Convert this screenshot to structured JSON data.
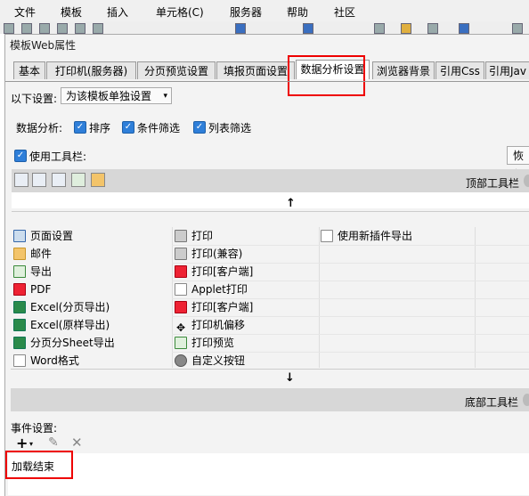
{
  "menu": [
    "文件",
    "模板",
    "插入",
    "单元格(C)",
    "服务器",
    "帮助",
    "社区"
  ],
  "dialog": {
    "title": "模板Web属性",
    "tabs": [
      "基本",
      "打印机(服务器)",
      "分页预览设置",
      "填报页面设置",
      "数据分析设置",
      "浏览器背景",
      "引用Css",
      "引用Jav"
    ],
    "settings_label": "以下设置:",
    "settings_value": "为该模板单独设置",
    "analysis_label": "数据分析:",
    "analysis_options": [
      "排序",
      "条件筛选",
      "列表筛选"
    ],
    "use_toolbar_label": "使用工具栏:",
    "restore_button": "恢复",
    "top_toolbar_label": "顶部工具栏",
    "bottom_toolbar_label": "底部工具栏",
    "event_label": "事件设置:",
    "event_item": "加载结束"
  },
  "buttons_col1": [
    "页面设置",
    "邮件",
    "导出",
    "PDF",
    "Excel(分页导出)",
    "Excel(原样导出)",
    "分页分Sheet导出",
    "Word格式"
  ],
  "buttons_col2": [
    "打印",
    "打印(兼容)",
    "打印[客户端]",
    "Applet打印",
    "打印[客户端]",
    "打印机偏移",
    "打印预览",
    "自定义按钮"
  ],
  "buttons_col3": [
    "使用新插件导出"
  ],
  "colors": {
    "accent": "#2f7fd9",
    "highlight": "#e00000"
  }
}
